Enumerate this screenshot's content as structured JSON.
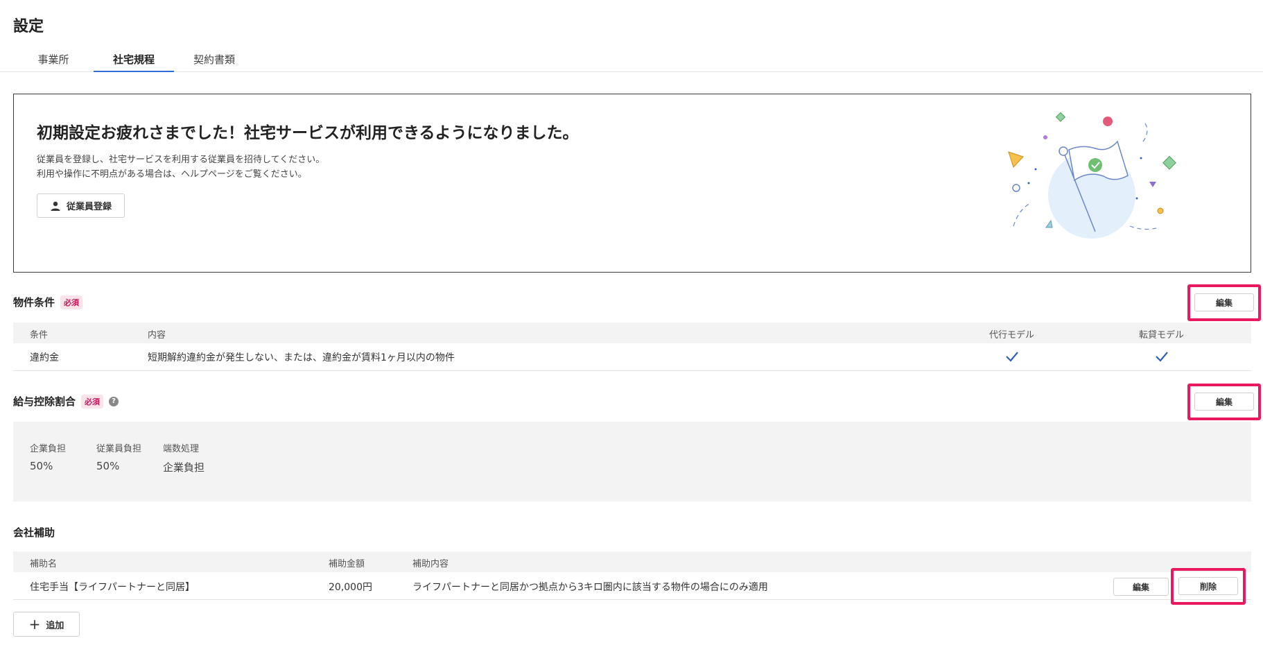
{
  "page": {
    "title": "設定"
  },
  "tabs": [
    {
      "label": "事業所"
    },
    {
      "label": "社宅規程"
    },
    {
      "label": "契約書類"
    }
  ],
  "banner": {
    "title": "初期設定お疲れさまでした！社宅サービスが利用できるようになりました。",
    "desc_line1": "従業員を登録し、社宅サービスを利用する従業員を招待してください。",
    "desc_line2": "利用や操作に不明点がある場合は、ヘルプページをご覧ください。",
    "register_button": "従業員登録"
  },
  "property_conditions": {
    "title": "物件条件",
    "badge": "必須",
    "edit_label": "編集",
    "headers": {
      "condition": "条件",
      "content": "内容",
      "agency_model": "代行モデル",
      "sublease_model": "転貸モデル"
    },
    "rows": [
      {
        "condition": "違約金",
        "content": "短期解約違約金が発生しない、または、違約金が賃料1ヶ月以内の物件",
        "agency_model": true,
        "sublease_model": true
      }
    ]
  },
  "salary_deduction": {
    "title": "給与控除割合",
    "badge": "必須",
    "help_icon": "?",
    "edit_label": "編集",
    "labels": {
      "company": "企業負担",
      "employee": "従業員負担",
      "rounding": "端数処理"
    },
    "values": {
      "company": "50%",
      "employee": "50%",
      "rounding": "企業負担"
    }
  },
  "company_subsidy": {
    "title": "会社補助",
    "headers": {
      "name": "補助名",
      "amount": "補助金額",
      "content": "補助内容"
    },
    "rows": [
      {
        "name": "住宅手当【ライフパートナーと同居】",
        "amount": "20,000円",
        "content": "ライフパートナーと同居かつ拠点から3キロ圏内に該当する物件の場合にのみ適用",
        "edit_label": "編集",
        "delete_label": "削除"
      }
    ],
    "add_label": "追加"
  },
  "colors": {
    "accent": "#2f6fd6",
    "highlight": "#e8195f",
    "badge_bg": "#fbe3ea",
    "badge_text": "#c2185b"
  }
}
